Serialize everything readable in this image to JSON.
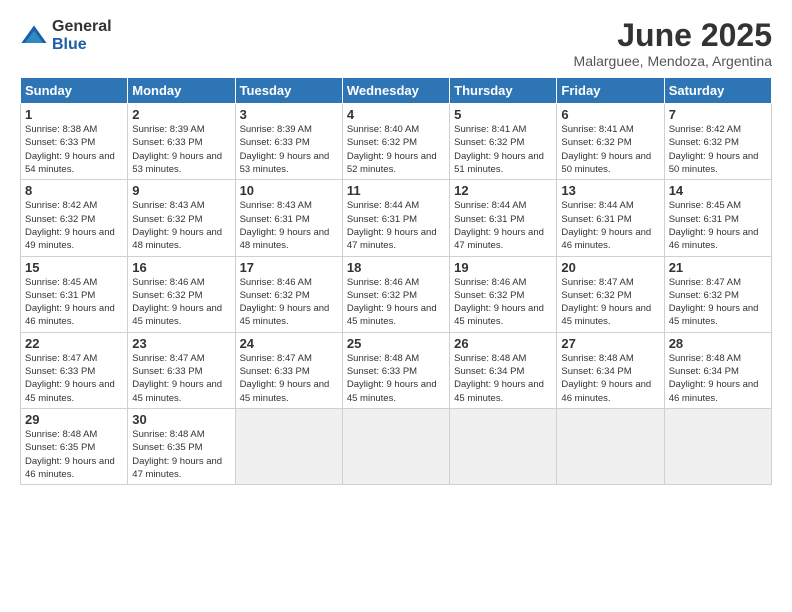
{
  "header": {
    "logo_general": "General",
    "logo_blue": "Blue",
    "title": "June 2025",
    "subtitle": "Malarguee, Mendoza, Argentina"
  },
  "calendar": {
    "columns": [
      "Sunday",
      "Monday",
      "Tuesday",
      "Wednesday",
      "Thursday",
      "Friday",
      "Saturday"
    ],
    "weeks": [
      [
        null,
        {
          "day": "2",
          "sunrise": "8:39 AM",
          "sunset": "6:33 PM",
          "daylight": "9 hours and 53 minutes."
        },
        {
          "day": "3",
          "sunrise": "8:39 AM",
          "sunset": "6:33 PM",
          "daylight": "9 hours and 53 minutes."
        },
        {
          "day": "4",
          "sunrise": "8:40 AM",
          "sunset": "6:32 PM",
          "daylight": "9 hours and 52 minutes."
        },
        {
          "day": "5",
          "sunrise": "8:41 AM",
          "sunset": "6:32 PM",
          "daylight": "9 hours and 51 minutes."
        },
        {
          "day": "6",
          "sunrise": "8:41 AM",
          "sunset": "6:32 PM",
          "daylight": "9 hours and 50 minutes."
        },
        {
          "day": "7",
          "sunrise": "8:42 AM",
          "sunset": "6:32 PM",
          "daylight": "9 hours and 50 minutes."
        }
      ],
      [
        {
          "day": "1",
          "sunrise": "8:38 AM",
          "sunset": "6:33 PM",
          "daylight": "9 hours and 54 minutes."
        },
        null,
        null,
        null,
        null,
        null,
        null
      ],
      [
        {
          "day": "8",
          "sunrise": "8:42 AM",
          "sunset": "6:32 PM",
          "daylight": "9 hours and 49 minutes."
        },
        {
          "day": "9",
          "sunrise": "8:43 AM",
          "sunset": "6:32 PM",
          "daylight": "9 hours and 48 minutes."
        },
        {
          "day": "10",
          "sunrise": "8:43 AM",
          "sunset": "6:31 PM",
          "daylight": "9 hours and 48 minutes."
        },
        {
          "day": "11",
          "sunrise": "8:44 AM",
          "sunset": "6:31 PM",
          "daylight": "9 hours and 47 minutes."
        },
        {
          "day": "12",
          "sunrise": "8:44 AM",
          "sunset": "6:31 PM",
          "daylight": "9 hours and 47 minutes."
        },
        {
          "day": "13",
          "sunrise": "8:44 AM",
          "sunset": "6:31 PM",
          "daylight": "9 hours and 46 minutes."
        },
        {
          "day": "14",
          "sunrise": "8:45 AM",
          "sunset": "6:31 PM",
          "daylight": "9 hours and 46 minutes."
        }
      ],
      [
        {
          "day": "15",
          "sunrise": "8:45 AM",
          "sunset": "6:31 PM",
          "daylight": "9 hours and 46 minutes."
        },
        {
          "day": "16",
          "sunrise": "8:46 AM",
          "sunset": "6:32 PM",
          "daylight": "9 hours and 45 minutes."
        },
        {
          "day": "17",
          "sunrise": "8:46 AM",
          "sunset": "6:32 PM",
          "daylight": "9 hours and 45 minutes."
        },
        {
          "day": "18",
          "sunrise": "8:46 AM",
          "sunset": "6:32 PM",
          "daylight": "9 hours and 45 minutes."
        },
        {
          "day": "19",
          "sunrise": "8:46 AM",
          "sunset": "6:32 PM",
          "daylight": "9 hours and 45 minutes."
        },
        {
          "day": "20",
          "sunrise": "8:47 AM",
          "sunset": "6:32 PM",
          "daylight": "9 hours and 45 minutes."
        },
        {
          "day": "21",
          "sunrise": "8:47 AM",
          "sunset": "6:32 PM",
          "daylight": "9 hours and 45 minutes."
        }
      ],
      [
        {
          "day": "22",
          "sunrise": "8:47 AM",
          "sunset": "6:33 PM",
          "daylight": "9 hours and 45 minutes."
        },
        {
          "day": "23",
          "sunrise": "8:47 AM",
          "sunset": "6:33 PM",
          "daylight": "9 hours and 45 minutes."
        },
        {
          "day": "24",
          "sunrise": "8:47 AM",
          "sunset": "6:33 PM",
          "daylight": "9 hours and 45 minutes."
        },
        {
          "day": "25",
          "sunrise": "8:48 AM",
          "sunset": "6:33 PM",
          "daylight": "9 hours and 45 minutes."
        },
        {
          "day": "26",
          "sunrise": "8:48 AM",
          "sunset": "6:34 PM",
          "daylight": "9 hours and 45 minutes."
        },
        {
          "day": "27",
          "sunrise": "8:48 AM",
          "sunset": "6:34 PM",
          "daylight": "9 hours and 46 minutes."
        },
        {
          "day": "28",
          "sunrise": "8:48 AM",
          "sunset": "6:34 PM",
          "daylight": "9 hours and 46 minutes."
        }
      ],
      [
        {
          "day": "29",
          "sunrise": "8:48 AM",
          "sunset": "6:35 PM",
          "daylight": "9 hours and 46 minutes."
        },
        {
          "day": "30",
          "sunrise": "8:48 AM",
          "sunset": "6:35 PM",
          "daylight": "9 hours and 47 minutes."
        },
        null,
        null,
        null,
        null,
        null
      ]
    ]
  }
}
